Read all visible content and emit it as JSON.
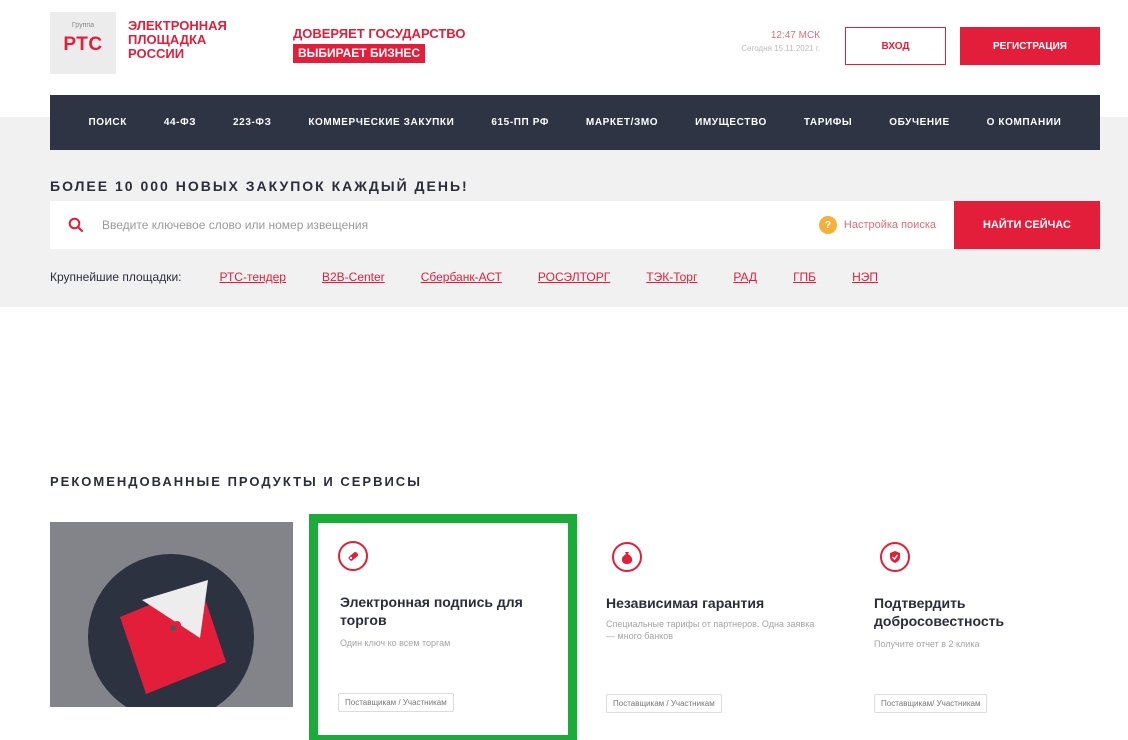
{
  "header": {
    "logo_small": "Группа",
    "logo_mark": "РТС",
    "logo_lines": [
      "ЭЛЕКТРОННАЯ",
      "ПЛОЩАДКА",
      "РОССИИ"
    ],
    "slogan_line1": "ДОВЕРЯЕТ ГОСУДАРСТВО",
    "slogan_line2": "ВЫБИРАЕТ БИЗНЕС",
    "time": "12:47 МСК",
    "date": "Сегодня 15.11.2021 г.",
    "login_label": "ВХОД",
    "register_label": "РЕГИСТРАЦИЯ"
  },
  "nav": {
    "items": [
      "ПОИСК",
      "44-ФЗ",
      "223-ФЗ",
      "КОММЕРЧЕСКИЕ ЗАКУПКИ",
      "615-ПП РФ",
      "МАРКЕТ/ЗМО",
      "ИМУЩЕСТВО",
      "ТАРИФЫ",
      "ОБУЧЕНИЕ",
      "О КОМПАНИИ"
    ]
  },
  "search": {
    "promo": "БОЛЕЕ 10 000 НОВЫХ ЗАКУПОК КАЖДЫЙ ДЕНЬ!",
    "placeholder": "Введите ключевое слово или номер извещения",
    "settings_badge": "?",
    "settings_label": "Настройка поиска",
    "submit_label": "НАЙТИ СЕЙЧАС",
    "platforms_label": "Крупнейшие площадки:",
    "platforms": [
      "РТС-тендер",
      "B2B-Center",
      "Сбербанк-АСТ",
      "РОСЭЛТОРГ",
      "ТЭК-Торг",
      "РАД",
      "ГПБ",
      "НЭП"
    ]
  },
  "recommended": {
    "title": "РЕКОМЕНДОВАННЫЕ ПРОДУКТЫ И СЕРВИСЫ",
    "cards": [
      {
        "icon": "pen-key-icon",
        "title": "Электронная подпись для торгов",
        "desc": "Один ключ ко всем торгам",
        "tag": "Поставщикам / Участникам"
      },
      {
        "icon": "money-bag-icon",
        "title": "Независимая гарантия",
        "desc": "Специальные тарифы от партнеров. Одна заявка — много банков",
        "tag": "Поставщикам / Участникам"
      },
      {
        "icon": "shield-check-icon",
        "title": "Подтвердить добросовестность",
        "desc": "Получите отчет в 2 клика",
        "tag": "Поставщикам/ Участникам"
      }
    ]
  },
  "colors": {
    "brand_red": "#e31e3a",
    "nav_bg": "#2e3444",
    "highlight_green": "#1aab38"
  }
}
